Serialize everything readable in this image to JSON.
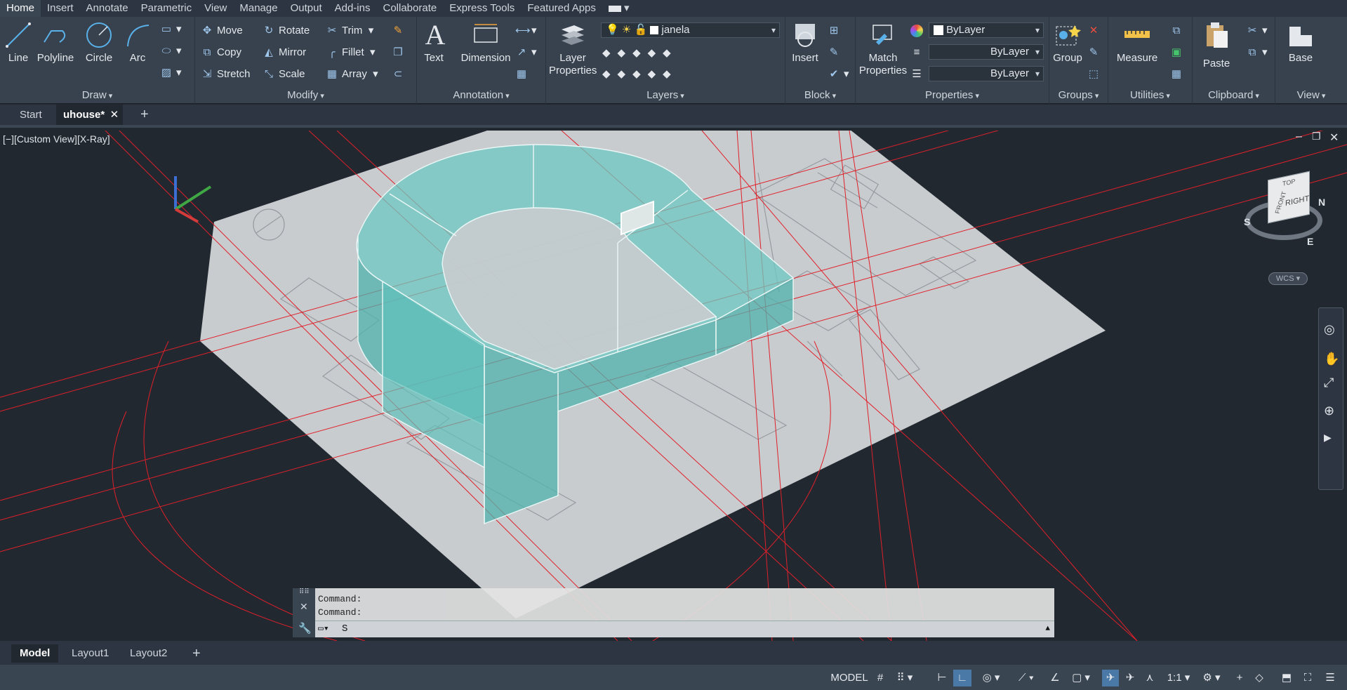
{
  "menubar": {
    "tabs": [
      "Home",
      "Insert",
      "Annotate",
      "Parametric",
      "View",
      "Manage",
      "Output",
      "Add-ins",
      "Collaborate",
      "Express Tools",
      "Featured Apps"
    ]
  },
  "ribbon": {
    "draw": {
      "title": "Draw",
      "line": "Line",
      "polyline": "Polyline",
      "circle": "Circle",
      "arc": "Arc"
    },
    "modify": {
      "title": "Modify",
      "move": "Move",
      "rotate": "Rotate",
      "trim": "Trim",
      "copy": "Copy",
      "mirror": "Mirror",
      "fillet": "Fillet",
      "stretch": "Stretch",
      "scale": "Scale",
      "array": "Array"
    },
    "annotation": {
      "title": "Annotation",
      "text": "Text",
      "dimension": "Dimension"
    },
    "layers": {
      "title": "Layers",
      "layer_properties": "Layer Properties",
      "current_layer": "janela"
    },
    "block": {
      "title": "Block",
      "insert": "Insert"
    },
    "properties": {
      "title": "Properties",
      "match": "Match Properties",
      "color": "ByLayer",
      "linetype": "ByLayer",
      "lineweight": "ByLayer"
    },
    "groups": {
      "title": "Groups",
      "group": "Group"
    },
    "utilities": {
      "title": "Utilities",
      "measure": "Measure"
    },
    "clipboard": {
      "title": "Clipboard",
      "paste": "Paste"
    },
    "view": {
      "title": "View",
      "base": "Base"
    }
  },
  "doctabs": {
    "start": "Start",
    "active": "uhouse*"
  },
  "viewport": {
    "label": "[−][Custom View][X-Ray]",
    "viewcube_top": "TOP",
    "viewcube_right": "RIGHT",
    "viewcube_front": "FRONT",
    "compass_n": "N",
    "compass_s": "S",
    "compass_e": "E",
    "wcs": "WCS"
  },
  "command": {
    "line1": "Command:",
    "line2": "Command:",
    "input": "S"
  },
  "layouttabs": {
    "model": "Model",
    "layout1": "Layout1",
    "layout2": "Layout2"
  },
  "status": {
    "model": "MODEL",
    "scale": "1:1"
  },
  "colors": {
    "accent": "#5ab0e8",
    "solid": "#5fc6c0",
    "redline": "#e0202a",
    "sheet": "#c9cccf"
  }
}
